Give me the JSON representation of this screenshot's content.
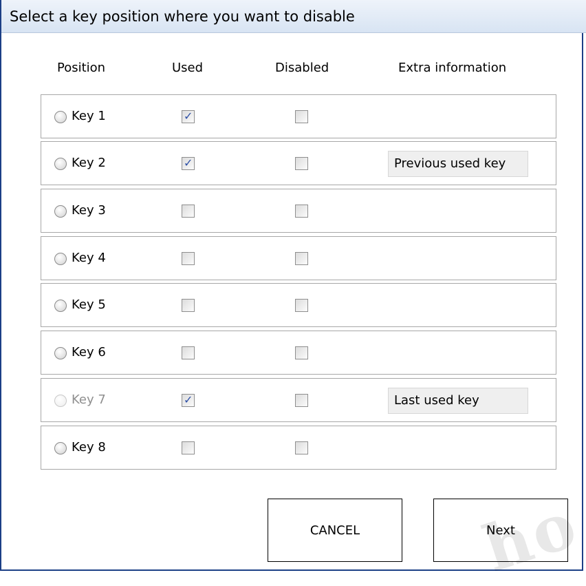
{
  "window": {
    "title": "Select a key position where you want to disable"
  },
  "headers": {
    "position": "Position",
    "used": "Used",
    "disabled": "Disabled",
    "extra": "Extra information"
  },
  "rows": [
    {
      "label": "Key 1",
      "used": true,
      "disabled": false,
      "radio_enabled": true,
      "extra": ""
    },
    {
      "label": "Key 2",
      "used": true,
      "disabled": false,
      "radio_enabled": true,
      "extra": "Previous used key"
    },
    {
      "label": "Key 3",
      "used": false,
      "disabled": false,
      "radio_enabled": true,
      "extra": ""
    },
    {
      "label": "Key 4",
      "used": false,
      "disabled": false,
      "radio_enabled": true,
      "extra": ""
    },
    {
      "label": "Key 5",
      "used": false,
      "disabled": false,
      "radio_enabled": true,
      "extra": ""
    },
    {
      "label": "Key 6",
      "used": false,
      "disabled": false,
      "radio_enabled": true,
      "extra": ""
    },
    {
      "label": "Key 7",
      "used": true,
      "disabled": false,
      "radio_enabled": false,
      "extra": "Last used key"
    },
    {
      "label": "Key 8",
      "used": false,
      "disabled": false,
      "radio_enabled": true,
      "extra": ""
    }
  ],
  "buttons": {
    "cancel": "CANCEL",
    "next": "Next"
  },
  "colors": {
    "title_bg": "#dbe6f4",
    "window_border": "#1c3f86",
    "check_mark": "#2d4fa5",
    "row_border": "#a7a7a7"
  }
}
